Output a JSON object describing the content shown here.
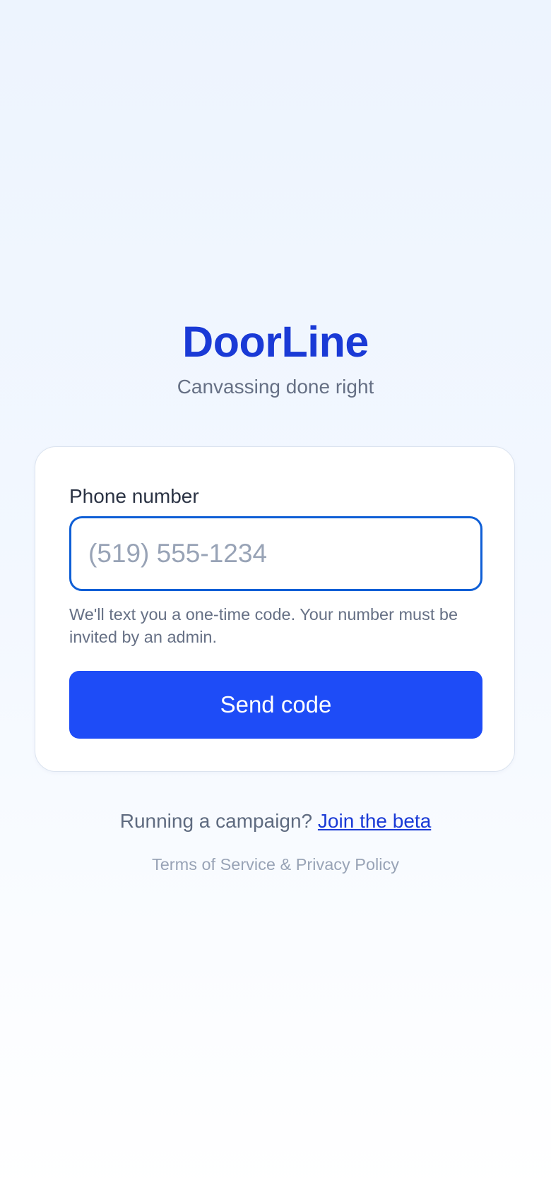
{
  "brand": {
    "title": "DoorLine",
    "tagline": "Canvassing done right"
  },
  "login_form": {
    "phone_label": "Phone number",
    "phone_value": "",
    "phone_placeholder": "(519) 555-1234",
    "hint": "We'll text you a one-time code. Your number must be invited by an admin.",
    "submit_label": "Send code"
  },
  "footer": {
    "beta_prompt": "Running a campaign?",
    "beta_link": "Join the beta",
    "terms_link": "Terms of Service",
    "legal_separator": "&",
    "privacy_link": "Privacy Policy"
  },
  "colors": {
    "brand": "#1a3ad6",
    "primary_button": "#1e4cf7",
    "input_focus_border": "#0f5fd6",
    "muted_text": "#667085",
    "background_top": "#edf4fe"
  }
}
